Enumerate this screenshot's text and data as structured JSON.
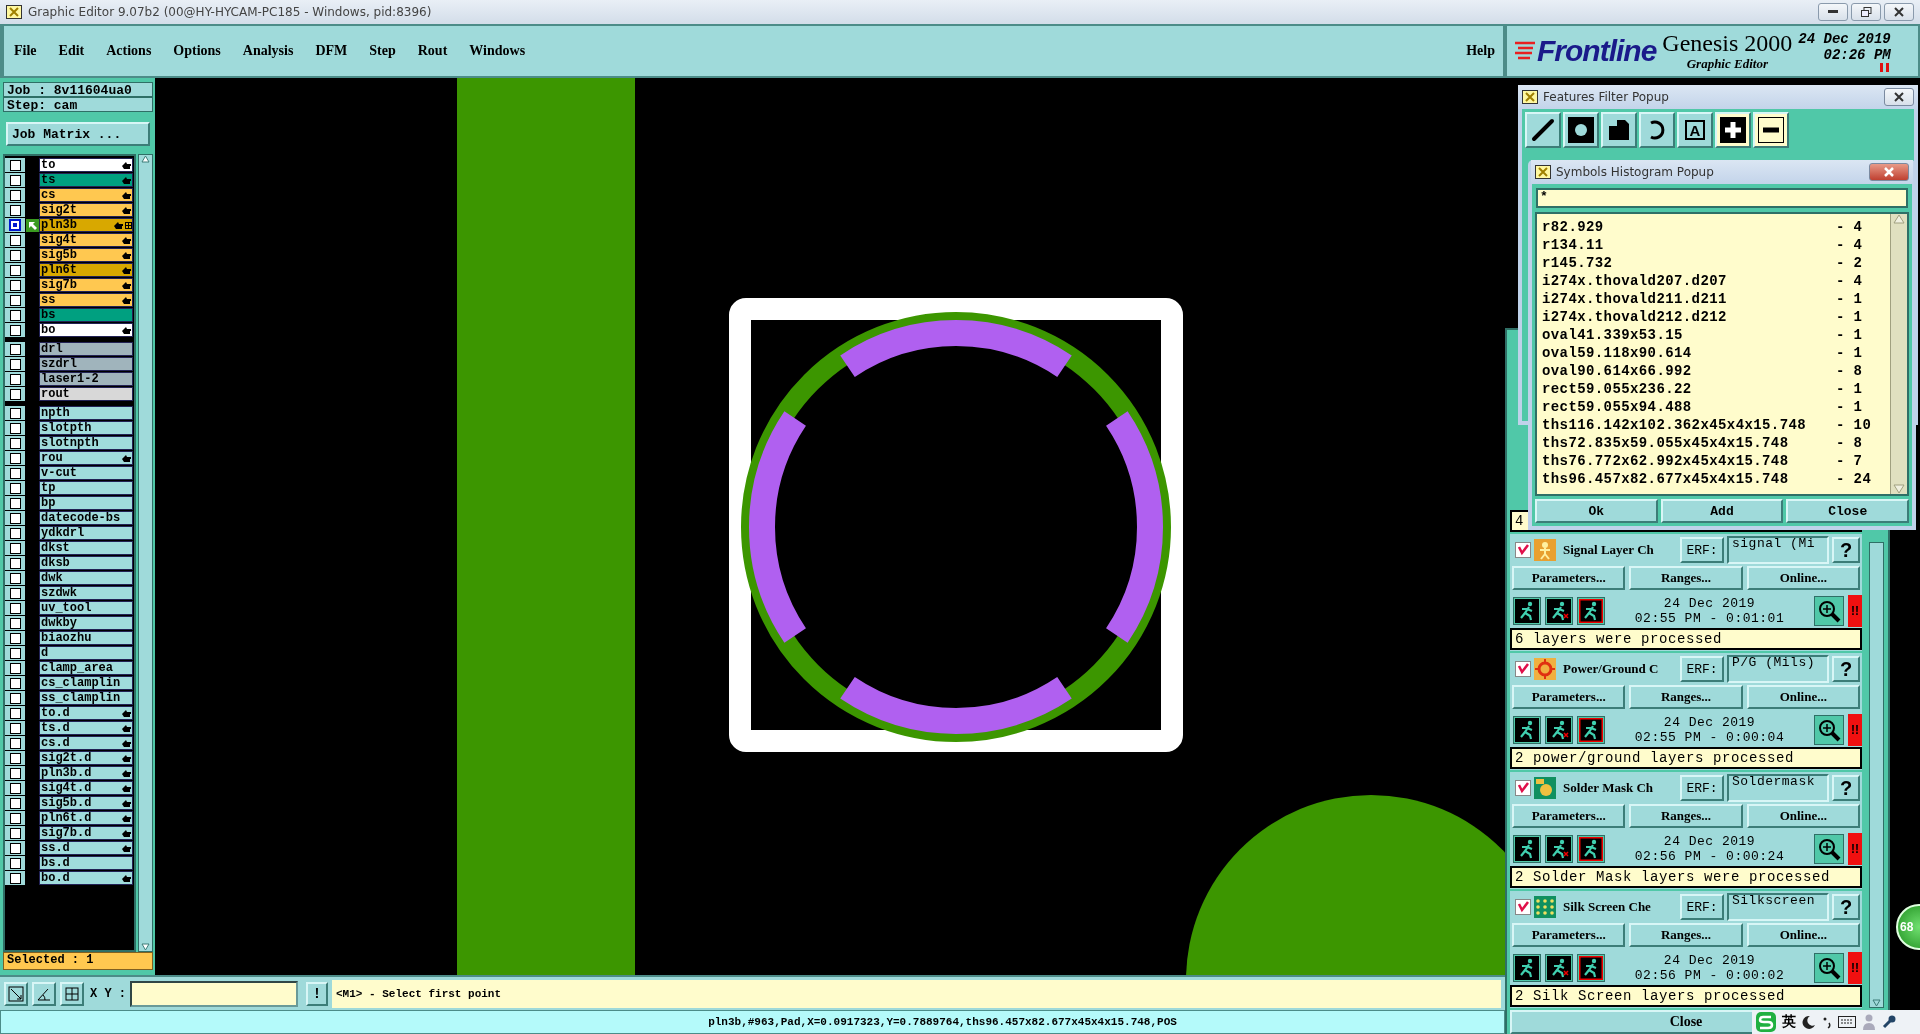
{
  "window": {
    "title": "Graphic Editor 9.07b2 (00@HY-HYCAM-PC185 - Windows, pid:8396)"
  },
  "menu": {
    "items": [
      "File",
      "Edit",
      "Actions",
      "Options",
      "Analysis",
      "DFM",
      "Step",
      "Rout",
      "Windows"
    ],
    "help": "Help"
  },
  "branding": {
    "logo": "Frontline",
    "product": "Genesis 2000",
    "subtitle": "Graphic Editor",
    "date": "24 Dec 2019",
    "time": "02:26 PM"
  },
  "job_panel": {
    "job": "Job : 8v11604ua0",
    "step": "Step: cam",
    "matrix_button": "Job Matrix ...",
    "selected_count": "Selected : 1",
    "layer_groups": [
      {
        "layers": [
          {
            "name": "to",
            "color": "#ffffff",
            "hand": true,
            "selected": false
          },
          {
            "name": "ts",
            "color": "#00a080",
            "hand": true,
            "selected": false
          },
          {
            "name": "cs",
            "color": "#ffc850",
            "hand": true,
            "selected": false
          },
          {
            "name": "sig2t",
            "color": "#ffc850",
            "hand": true,
            "selected": false
          },
          {
            "name": "pln3b",
            "color": "#d8a800",
            "hand": true,
            "selected": true
          },
          {
            "name": "sig4t",
            "color": "#ffc850",
            "hand": true,
            "selected": false
          },
          {
            "name": "sig5b",
            "color": "#ffc850",
            "hand": true,
            "selected": false
          },
          {
            "name": "pln6t",
            "color": "#d8a800",
            "hand": true,
            "selected": false
          },
          {
            "name": "sig7b",
            "color": "#ffc850",
            "hand": true,
            "selected": false
          },
          {
            "name": "ss",
            "color": "#ffc850",
            "hand": true,
            "selected": false
          },
          {
            "name": "bs",
            "color": "#00a080",
            "hand": false,
            "selected": false
          },
          {
            "name": "bo",
            "color": "#ffffff",
            "hand": true,
            "selected": false
          }
        ]
      },
      {
        "layers": [
          {
            "name": "drl",
            "color": "#a0b4bc",
            "hand": false,
            "selected": false
          },
          {
            "name": "szdrl",
            "color": "#a0b4bc",
            "hand": false,
            "selected": false
          },
          {
            "name": "laser1-2",
            "color": "#a0b4bc",
            "hand": false,
            "selected": false
          },
          {
            "name": "rout",
            "color": "#d8d8d8",
            "hand": false,
            "selected": false
          }
        ]
      },
      {
        "layers": [
          {
            "name": "npth",
            "color": "#a0dcdc",
            "hand": false,
            "selected": false
          },
          {
            "name": "slotpth",
            "color": "#a0dcdc",
            "hand": false,
            "selected": false
          },
          {
            "name": "slotnpth",
            "color": "#a0dcdc",
            "hand": false,
            "selected": false
          },
          {
            "name": "rou",
            "color": "#a0dcdc",
            "hand": true,
            "selected": false
          },
          {
            "name": "v-cut",
            "color": "#a0dcdc",
            "hand": false,
            "selected": false
          },
          {
            "name": "tp",
            "color": "#a0dcdc",
            "hand": false,
            "selected": false
          },
          {
            "name": "bp",
            "color": "#a0dcdc",
            "hand": false,
            "selected": false
          },
          {
            "name": "datecode-bs",
            "color": "#a0dcdc",
            "hand": false,
            "selected": false
          },
          {
            "name": "ydkdrl",
            "color": "#a0dcdc",
            "hand": false,
            "selected": false
          },
          {
            "name": "dkst",
            "color": "#a0dcdc",
            "hand": false,
            "selected": false
          },
          {
            "name": "dksb",
            "color": "#a0dcdc",
            "hand": false,
            "selected": false
          },
          {
            "name": "dwk",
            "color": "#a0dcdc",
            "hand": false,
            "selected": false
          },
          {
            "name": "szdwk",
            "color": "#a0dcdc",
            "hand": false,
            "selected": false
          },
          {
            "name": "uv_tool",
            "color": "#a0dcdc",
            "hand": false,
            "selected": false
          },
          {
            "name": "dwkby",
            "color": "#a0dcdc",
            "hand": false,
            "selected": false
          },
          {
            "name": "biaozhu",
            "color": "#a0dcdc",
            "hand": false,
            "selected": false
          },
          {
            "name": "d",
            "color": "#a0dcdc",
            "hand": false,
            "selected": false
          },
          {
            "name": "clamp_area",
            "color": "#a0dcdc",
            "hand": false,
            "selected": false
          },
          {
            "name": "cs_clamplin",
            "color": "#a0dcdc",
            "hand": false,
            "selected": false
          },
          {
            "name": "ss_clamplin",
            "color": "#a0dcdc",
            "hand": false,
            "selected": false
          },
          {
            "name": "to.d",
            "color": "#a0dcdc",
            "hand": true,
            "selected": false
          },
          {
            "name": "ts.d",
            "color": "#a0dcdc",
            "hand": true,
            "selected": false
          },
          {
            "name": "cs.d",
            "color": "#a0dcdc",
            "hand": true,
            "selected": false
          },
          {
            "name": "sig2t.d",
            "color": "#a0dcdc",
            "hand": true,
            "selected": false
          },
          {
            "name": "pln3b.d",
            "color": "#a0dcdc",
            "hand": true,
            "selected": false
          },
          {
            "name": "sig4t.d",
            "color": "#a0dcdc",
            "hand": true,
            "selected": false
          },
          {
            "name": "sig5b.d",
            "color": "#a0dcdc",
            "hand": true,
            "selected": false
          },
          {
            "name": "pln6t.d",
            "color": "#a0dcdc",
            "hand": true,
            "selected": false
          },
          {
            "name": "sig7b.d",
            "color": "#a0dcdc",
            "hand": true,
            "selected": false
          },
          {
            "name": "ss.d",
            "color": "#a0dcdc",
            "hand": true,
            "selected": false
          },
          {
            "name": "bs.d",
            "color": "#a0dcdc",
            "hand": false,
            "selected": false
          },
          {
            "name": "bo.d",
            "color": "#a0dcdc",
            "hand": true,
            "selected": false
          }
        ]
      }
    ]
  },
  "command_bar": {
    "xy_label": "X Y :",
    "prompt_button": "!",
    "prompt": "<M1> - Select first point"
  },
  "status_bar": "pln3b,#963,Pad,X=0.0917323,Y=0.7889764,ths96.457x82.677x45x4x15.748,POS",
  "features_filter": {
    "title": "Features Filter Popup",
    "text_button": "A"
  },
  "symbols_histogram": {
    "title": "Symbols Histogram Popup",
    "filter": "*",
    "rows": [
      {
        "symbol": "r82.929",
        "count": "- 4"
      },
      {
        "symbol": "r134.11",
        "count": "- 4"
      },
      {
        "symbol": "r145.732",
        "count": "- 2"
      },
      {
        "symbol": "i274x.thovald207.d207",
        "count": "- 4"
      },
      {
        "symbol": "i274x.thovald211.d211",
        "count": "- 1"
      },
      {
        "symbol": "i274x.thovald212.d212",
        "count": "- 1"
      },
      {
        "symbol": "oval41.339x53.15",
        "count": "- 1"
      },
      {
        "symbol": "oval59.118x90.614",
        "count": "- 1"
      },
      {
        "symbol": "oval90.614x66.992",
        "count": "- 8"
      },
      {
        "symbol": "rect59.055x236.22",
        "count": "- 1"
      },
      {
        "symbol": "rect59.055x94.488",
        "count": "- 1"
      },
      {
        "symbol": "ths116.142x102.362x45x4x15.748",
        "count": "- 10"
      },
      {
        "symbol": "ths72.835x59.055x45x4x15.748",
        "count": "- 8"
      },
      {
        "symbol": "ths76.772x62.992x45x4x15.748",
        "count": "- 7"
      },
      {
        "symbol": "ths96.457x82.677x45x4x15.748",
        "count": "- 24"
      }
    ],
    "buttons": [
      "Ok",
      "Add",
      "Close"
    ]
  },
  "dfm": {
    "hidden_message": "4",
    "sections": [
      {
        "kind": "signal",
        "checked": true,
        "name": "Signal Layer Ch",
        "erf_label": "ERF:",
        "erf": "signal (Mi",
        "help": "?",
        "buttons": [
          "Parameters...",
          "Ranges...",
          "Online..."
        ],
        "date": "24 Dec 2019",
        "time": "02:55 PM - 0:01:01",
        "alert": "!!",
        "message": "6 layers were processed"
      },
      {
        "kind": "power_ground",
        "checked": true,
        "name": "Power/Ground C",
        "erf_label": "ERF:",
        "erf": "P/G (Mils)",
        "help": "?",
        "buttons": [
          "Parameters...",
          "Ranges...",
          "Online..."
        ],
        "date": "24 Dec 2019",
        "time": "02:55 PM - 0:00:04",
        "alert": "!!",
        "message": "2 power/ground layers processed"
      },
      {
        "kind": "solder_mask",
        "checked": true,
        "name": "Solder Mask Ch",
        "erf_label": "ERF:",
        "erf": "Soldermask",
        "help": "?",
        "buttons": [
          "Parameters...",
          "Ranges...",
          "Online..."
        ],
        "date": "24 Dec 2019",
        "time": "02:56 PM - 0:00:24",
        "alert": "!!",
        "message": "2 Solder Mask layers were processed"
      },
      {
        "kind": "silk_screen",
        "checked": true,
        "name": "Silk Screen Che",
        "erf_label": "ERF:",
        "erf": "Silkscreen",
        "help": "?",
        "buttons": [
          "Parameters...",
          "Ranges...",
          "Online..."
        ],
        "date": "24 Dec 2019",
        "time": "02:56 PM - 0:00:02",
        "alert": "!!",
        "message": "2 Silk Screen layers processed"
      }
    ],
    "close": "Close"
  },
  "tray": {
    "ime": "英",
    "badge": "68"
  }
}
